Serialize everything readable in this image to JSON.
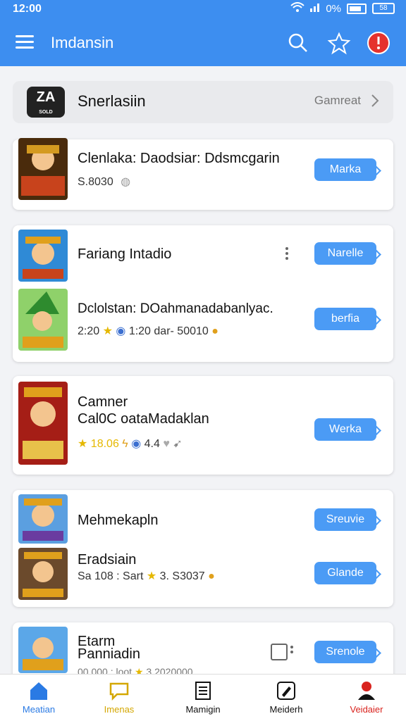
{
  "status": {
    "time": "12:00",
    "battery_percent": "0%",
    "battery_badge": "58"
  },
  "app": {
    "title": "Imdansin"
  },
  "header": {
    "logo_text": "ZA",
    "logo_small": "SOLD",
    "name": "Snerlasiin",
    "right_label": "Gamreat"
  },
  "cards": [
    {
      "title": "Clenlaka: Daodsiar: Ddsmcgarin",
      "sub": "S.8030",
      "button": "Marka"
    },
    {
      "title": "Fariang Intadio",
      "button": "Narelle",
      "title2": "Dclolstan: DOahmanadabanlyac.",
      "sub2": "2:20",
      "sub2b": "1:20 dar- 50010",
      "button2": "berfia"
    },
    {
      "title": "Camner",
      "title2": "Cal0C oataMadaklan",
      "sub_gold": "18.06",
      "sub": "4.4",
      "button": "Werka"
    },
    {
      "title": "Mehmekapln",
      "button": "Sreuvie",
      "title2": "Eradsiain",
      "sub2": "Sa 108 : Sart",
      "sub2b": "3. S3037",
      "button2": "Glande"
    },
    {
      "title": "Etarm",
      "title2": "Panniadin",
      "sub": "00.000 : loot",
      "sub_b": "3 2020000",
      "button": "Srenole"
    }
  ],
  "nav": [
    {
      "label": "Meatian",
      "color": "#2a7ae4"
    },
    {
      "label": "Imenas",
      "color": "#d4a700"
    },
    {
      "label": "Mamigin",
      "color": "#111111"
    },
    {
      "label": "Meiderh",
      "color": "#111111"
    },
    {
      "label": "Veidaier",
      "color": "#d9231e"
    }
  ],
  "colors": {
    "brand": "#3d8ef0",
    "button": "#4b9bf5",
    "alert": "#e5322d"
  }
}
